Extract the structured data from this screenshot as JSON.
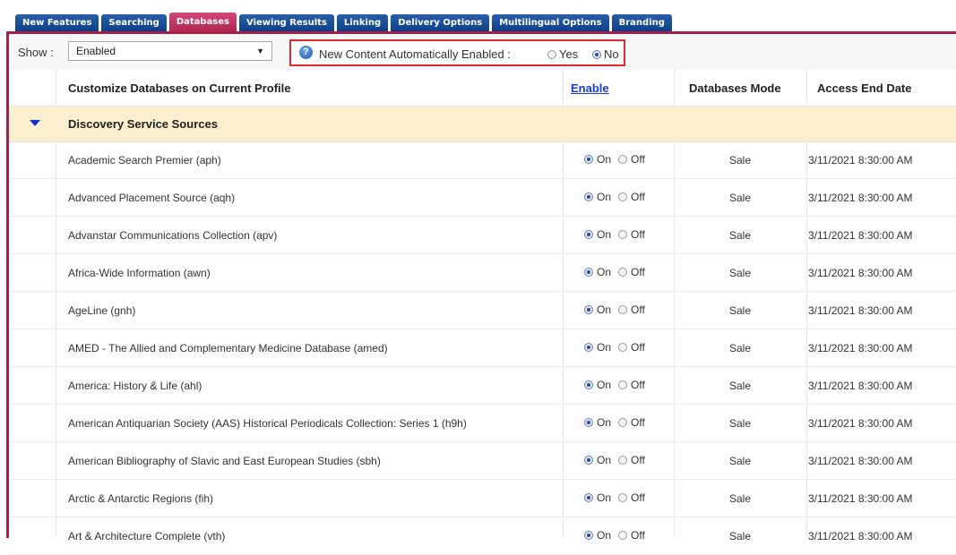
{
  "tabs": [
    {
      "label": "New Features"
    },
    {
      "label": "Searching"
    },
    {
      "label": "Databases"
    },
    {
      "label": "Viewing Results"
    },
    {
      "label": "Linking"
    },
    {
      "label": "Delivery Options"
    },
    {
      "label": "Multilingual Options"
    },
    {
      "label": "Branding"
    }
  ],
  "active_tab": "Databases",
  "show": {
    "label": "Show :",
    "selected": "Enabled"
  },
  "auto_content": {
    "label": "New Content Automatically Enabled :",
    "yes_label": "Yes",
    "no_label": "No",
    "selected": "No"
  },
  "table": {
    "headers": {
      "name": "Customize Databases on Current Profile",
      "enable": "Enable",
      "mode": "Databases Mode",
      "end_date": "Access End Date"
    },
    "group": {
      "title": "Discovery Service Sources"
    },
    "on_label": "On",
    "off_label": "Off",
    "rows": [
      {
        "name": "Academic Search Premier (aph)",
        "state": "On",
        "mode": "Sale",
        "end_date": "3/11/2021 8:30:00 AM"
      },
      {
        "name": "Advanced Placement Source (aqh)",
        "state": "On",
        "mode": "Sale",
        "end_date": "3/11/2021 8:30:00 AM"
      },
      {
        "name": "Advanstar Communications Collection (apv)",
        "state": "On",
        "mode": "Sale",
        "end_date": "3/11/2021 8:30:00 AM"
      },
      {
        "name": "Africa-Wide Information (awn)",
        "state": "On",
        "mode": "Sale",
        "end_date": "3/11/2021 8:30:00 AM"
      },
      {
        "name": "AgeLine (gnh)",
        "state": "On",
        "mode": "Sale",
        "end_date": "3/11/2021 8:30:00 AM"
      },
      {
        "name": "AMED - The Allied and Complementary Medicine Database (amed)",
        "state": "On",
        "mode": "Sale",
        "end_date": "3/11/2021 8:30:00 AM"
      },
      {
        "name": "America: History & Life (ahl)",
        "state": "On",
        "mode": "Sale",
        "end_date": "3/11/2021 8:30:00 AM"
      },
      {
        "name": "American Antiquarian Society (AAS) Historical Periodicals Collection: Series 1 (h9h)",
        "state": "On",
        "mode": "Sale",
        "end_date": "3/11/2021 8:30:00 AM"
      },
      {
        "name": "American Bibliography of Slavic and East European Studies (sbh)",
        "state": "On",
        "mode": "Sale",
        "end_date": "3/11/2021 8:30:00 AM"
      },
      {
        "name": "Arctic & Antarctic Regions (fih)",
        "state": "On",
        "mode": "Sale",
        "end_date": "3/11/2021 8:30:00 AM"
      },
      {
        "name": "Art & Architecture Complete (vth)",
        "state": "On",
        "mode": "Sale",
        "end_date": "3/11/2021 8:30:00 AM"
      }
    ]
  },
  "colors": {
    "tab_blue": "#0c3e86",
    "tab_active": "#b0264f",
    "group_bg": "#fbefcf",
    "highlight_border": "#e0282f"
  }
}
